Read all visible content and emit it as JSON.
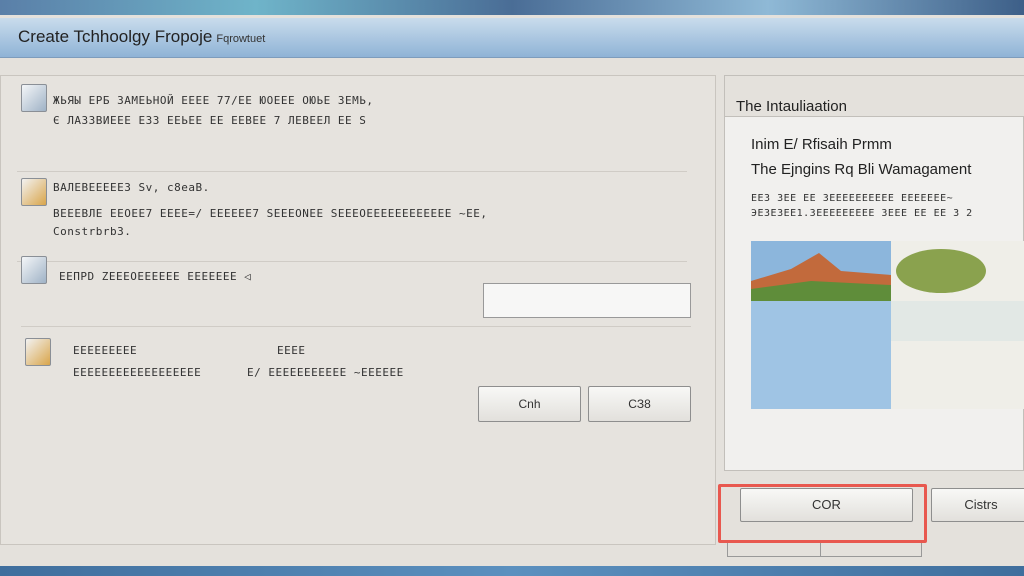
{
  "window": {
    "title": "Create Tchhoolgy Fropoje",
    "title_suffix": "Fqrowtuet"
  },
  "sections": [
    {
      "lines": [
        "ЖЬЯЫ ЕРБ ЗАМЕЬНОЙ ЕЕЕЕ 77/ЕЕ ЮОЕЕЕ ОЮЬЕ ЗЕМЬ,",
        "Є ЛАЗЗВИЕЕЕ ЕЗЗ ЕЕЬЕЕ ЕЕ ЕЕВЕЕ 7 ЛЕВЕЕЛ ЕЕ Ѕ"
      ]
    },
    {
      "lines": [
        "ВАЛЕВЕЕЕЕЕЗ Sv, c8eaB.",
        "ВЕЕЕВЛЕ ЕЕОЕЕ7  ЕЕЕЕ=/ ЕЕЕЕЕЕ7  SЕЕЕОNЕЕ  SЕЕЕОЕЕЕЕЕЕЕЕЕЕЕЕ ~ЕЕ,",
        "Constrbrb3."
      ]
    },
    {
      "lines": [
        "ЕЕПРD ZЕЕЕОЕЕЕЕЕЕ ЕЕЕЕЕЕЕ ◁"
      ],
      "input_value": ""
    },
    {
      "lines": [
        "ЕЕЕЕЕЕЕЕЕ",
        "ЕЕЕЕЕЕЕЕЕЕЕЕЕЕЕЕЕЕ"
      ],
      "col2_lines": [
        "ЕЕЕЕ",
        "E/ ЕЕЕЕЕЕЕЕЕЕЕ ~ЕЕЕЕЕЕ"
      ]
    }
  ],
  "left_buttons": [
    "Cnh",
    "CЗ8"
  ],
  "preview": {
    "header": "The Intauliaation",
    "line1": "Inim E/ Rfisaih Prmm",
    "line2": "The Ejngins Rq Bli Wamagament",
    "small1": "ЕЕЗ ЗЕЕ ЕЕ ЗЕЕЕЕЕЕЕЕЕЕ ЕЕЕЕЕЕЕ~",
    "small2": "ЭЕЗЕЗЕЕ1.ЗЕЕЕЕЕЕЕЕЕ ЗЕЕЕ ЕЕ ЕЕ 3 2"
  },
  "footer_buttons": {
    "primary": "COR",
    "secondary": "Cistrs"
  },
  "colors": {
    "highlight": "#e8584f",
    "titlebar": "#a9c6e2"
  }
}
